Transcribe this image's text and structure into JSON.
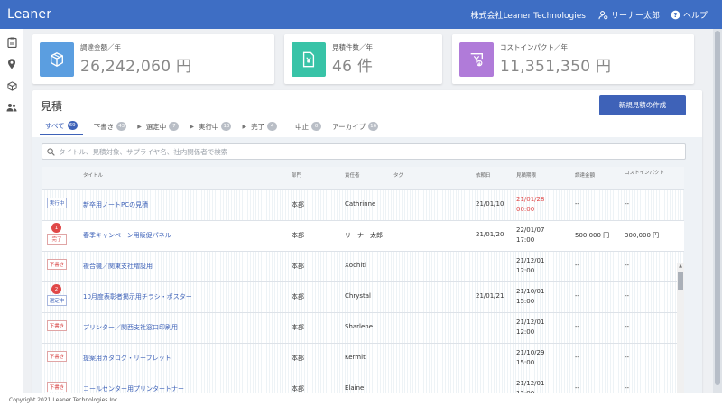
{
  "app": {
    "title": "Leaner"
  },
  "header": {
    "company": "株式会社Leaner Technologies",
    "user": "リーナー太郎",
    "help": "ヘルプ"
  },
  "sidebar": {
    "items": [
      {
        "icon": "clipboard-icon"
      },
      {
        "icon": "location-pin-icon"
      },
      {
        "icon": "box-icon"
      },
      {
        "icon": "people-icon"
      }
    ]
  },
  "stats": [
    {
      "label": "調達金額／年",
      "value": "26,242,060 円",
      "color": "#5b9ee0",
      "icon": "cube-icon"
    },
    {
      "label": "見積件数／年",
      "value": "46 件",
      "color": "#38c3a7",
      "icon": "document-yen-icon"
    },
    {
      "label": "コストインパクト／年",
      "value": "11,351,350 円",
      "color": "#b07bd9",
      "icon": "cost-impact-icon"
    }
  ],
  "quotes": {
    "title": "見積",
    "new_button": "新規見積の作成",
    "tabs": [
      {
        "label": "すべて",
        "count": "69"
      },
      {
        "label": "下書き",
        "count": "43"
      },
      {
        "label": "選定中",
        "count": "7"
      },
      {
        "label": "実行中",
        "count": "13"
      },
      {
        "label": "完了",
        "count": "4"
      },
      {
        "label": "中止",
        "count": "0"
      },
      {
        "label": "アーカイブ",
        "count": "16"
      }
    ],
    "search_placeholder": "タイトル、見積対象、サプライヤ名、社内関係者で検索",
    "columns": {
      "title": "タイトル",
      "department": "部門",
      "owner": "責任者",
      "tag": "タグ",
      "request_date": "依頼日",
      "deadline": "見積期限",
      "amount": "調達金額",
      "impact": "コストインパクト"
    },
    "rows": [
      {
        "status": "実行中",
        "status_type": "blue",
        "count": "",
        "title": "新卒用ノートPCの見積",
        "department": "本部",
        "owner": "Cathrinne",
        "request_date": "21/01/10",
        "deadline_date": "21/01/28",
        "deadline_time": "00:00",
        "deadline_overdue": "true",
        "amount": "--",
        "impact": "--"
      },
      {
        "status": "完了",
        "status_type": "red",
        "count": "1",
        "title": "春季キャンペーン用販促パネル",
        "department": "本部",
        "owner": "リーナー太郎",
        "request_date": "21/01/20",
        "deadline_date": "22/01/07",
        "deadline_time": "17:00",
        "deadline_overdue": "false",
        "amount": "500,000 円",
        "impact": "300,000 円"
      },
      {
        "status": "下書き",
        "status_type": "red",
        "count": "",
        "title": "複合機／関東支社増設用",
        "department": "本部",
        "owner": "Xochitl",
        "request_date": "",
        "deadline_date": "21/12/01",
        "deadline_time": "12:00",
        "deadline_overdue": "false",
        "amount": "--",
        "impact": "--"
      },
      {
        "status": "選定中",
        "status_type": "blue",
        "count": "2",
        "title": "10月度表彰者掲示用チラシ・ポスター",
        "department": "本部",
        "owner": "Chrystal",
        "request_date": "21/01/21",
        "deadline_date": "21/10/01",
        "deadline_time": "15:00",
        "deadline_overdue": "false",
        "amount": "--",
        "impact": "--"
      },
      {
        "status": "下書き",
        "status_type": "red",
        "count": "",
        "title": "プリンター／関西支社窓口印刷用",
        "department": "本部",
        "owner": "Sharlene",
        "request_date": "",
        "deadline_date": "21/12/01",
        "deadline_time": "12:00",
        "deadline_overdue": "false",
        "amount": "--",
        "impact": "--"
      },
      {
        "status": "下書き",
        "status_type": "red",
        "count": "",
        "title": "提案用カタログ・リーフレット",
        "department": "本部",
        "owner": "Kermit",
        "request_date": "",
        "deadline_date": "21/10/29",
        "deadline_time": "15:00",
        "deadline_overdue": "false",
        "amount": "--",
        "impact": "--"
      },
      {
        "status": "下書き",
        "status_type": "red",
        "count": "",
        "title": "コールセンター用プリンタートナー",
        "department": "本部",
        "owner": "Elaine",
        "request_date": "",
        "deadline_date": "21/12/01",
        "deadline_time": "12:00",
        "deadline_overdue": "false",
        "amount": "--",
        "impact": "--"
      }
    ]
  },
  "footer": {
    "copyright": "Copyright 2021 Leaner Technologies Inc."
  }
}
